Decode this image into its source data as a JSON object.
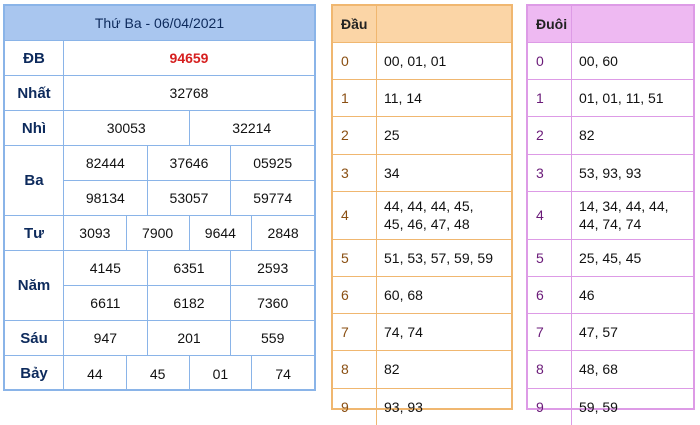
{
  "main": {
    "title": "Thứ Ba - 06/04/2021",
    "prizes": [
      {
        "label": "ĐB",
        "rows": [
          [
            "94659"
          ]
        ],
        "highlight": true
      },
      {
        "label": "Nhất",
        "rows": [
          [
            "32768"
          ]
        ]
      },
      {
        "label": "Nhì",
        "rows": [
          [
            "30053",
            "32214"
          ]
        ]
      },
      {
        "label": "Ba",
        "rows": [
          [
            "82444",
            "37646",
            "05925"
          ],
          [
            "98134",
            "53057",
            "59774"
          ]
        ]
      },
      {
        "label": "Tư",
        "rows": [
          [
            "3093",
            "7900",
            "9644",
            "2848"
          ]
        ]
      },
      {
        "label": "Năm",
        "rows": [
          [
            "4145",
            "6351",
            "2593"
          ],
          [
            "6611",
            "6182",
            "7360"
          ]
        ]
      },
      {
        "label": "Sáu",
        "rows": [
          [
            "947",
            "201",
            "559"
          ]
        ]
      },
      {
        "label": "Bảy",
        "rows": [
          [
            "44",
            "45",
            "01",
            "74"
          ]
        ]
      }
    ]
  },
  "dau": {
    "header": "Đầu",
    "rows": [
      {
        "k": "0",
        "v": "00, 01, 01"
      },
      {
        "k": "1",
        "v": "11, 14"
      },
      {
        "k": "2",
        "v": "25"
      },
      {
        "k": "3",
        "v": "34"
      },
      {
        "k": "4",
        "v": "44, 44, 44, 45,\n45, 46, 47, 48"
      },
      {
        "k": "5",
        "v": "51, 53, 57, 59, 59"
      },
      {
        "k": "6",
        "v": "60, 68"
      },
      {
        "k": "7",
        "v": "74, 74"
      },
      {
        "k": "8",
        "v": "82"
      },
      {
        "k": "9",
        "v": "93, 93"
      }
    ]
  },
  "duoi": {
    "header": "Đuôi",
    "rows": [
      {
        "k": "0",
        "v": "00, 60"
      },
      {
        "k": "1",
        "v": "01, 01, 11, 51"
      },
      {
        "k": "2",
        "v": "82"
      },
      {
        "k": "3",
        "v": "53, 93, 93"
      },
      {
        "k": "4",
        "v": "14, 34, 44, 44,\n44, 74, 74"
      },
      {
        "k": "5",
        "v": "25, 45, 45"
      },
      {
        "k": "6",
        "v": "46"
      },
      {
        "k": "7",
        "v": "47, 57"
      },
      {
        "k": "8",
        "v": "48, 68"
      },
      {
        "k": "9",
        "v": "59, 59"
      }
    ]
  },
  "colors": {
    "main_border": "#8ab4e8",
    "main_header": "#a9c6ef",
    "special_prize": "#d61f1f",
    "dau_border": "#f0b770",
    "dau_header": "#fbd5a6",
    "duoi_border": "#dd9be6",
    "duoi_header": "#eeb9f2"
  }
}
